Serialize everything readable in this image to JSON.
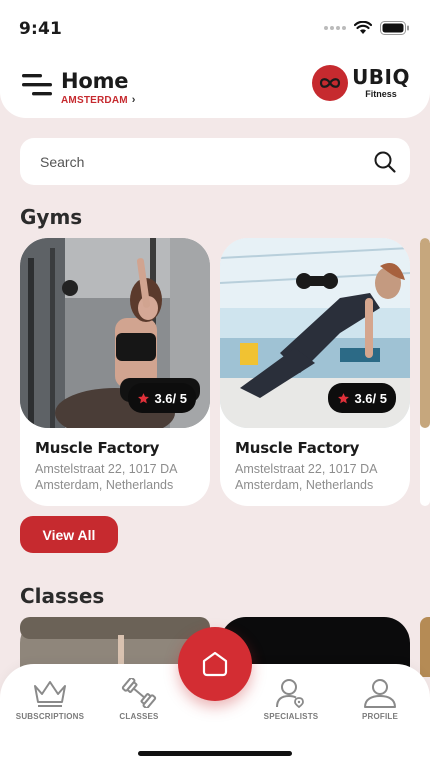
{
  "status_bar": {
    "time": "9:41"
  },
  "header": {
    "title": "Home",
    "location": "AMSTERDAM",
    "brand_name": "UBIQ",
    "brand_sub": "Fitness"
  },
  "search": {
    "placeholder": "Search"
  },
  "gyms": {
    "title": "Gyms",
    "items": [
      {
        "name": "Muscle Factory",
        "rating": "3.6/ 5",
        "address": "Amstelstraat 22, 1017 DA Amsterdam, Netherlands"
      },
      {
        "name": "Muscle Factory",
        "rating": "3.6/ 5",
        "address": "Amstelstraat 22, 1017 DA Amsterdam, Netherlands"
      }
    ],
    "view_all_label": "View All"
  },
  "classes": {
    "title": "Classes"
  },
  "tabbar": {
    "items": [
      {
        "label": "SUBSCRIPTIONS",
        "icon": "crown-icon"
      },
      {
        "label": "CLASSES",
        "icon": "dumbbell-icon"
      },
      {
        "label": "SPECIALISTS",
        "icon": "specialist-icon"
      },
      {
        "label": "PROFILE",
        "icon": "profile-icon"
      }
    ],
    "center_icon": "home-icon"
  },
  "colors": {
    "accent": "#c62a2f",
    "background": "#f3e8e8"
  }
}
